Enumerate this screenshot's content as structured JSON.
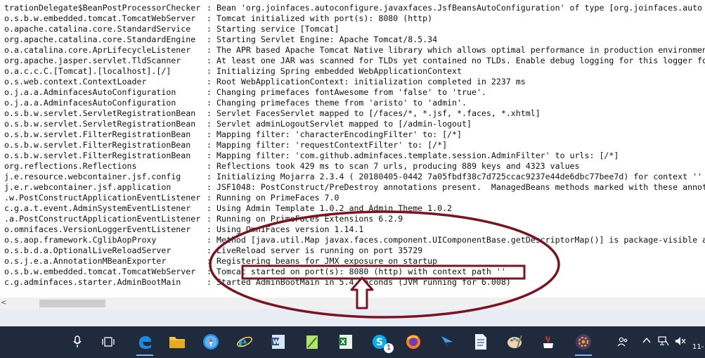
{
  "console": {
    "lines": [
      {
        "logger": "trationDelegate$BeanPostProcessorChecker",
        "message": "Bean 'org.joinfaces.autoconfigure.javaxfaces.JsfBeansAutoConfiguration' of type [org.joinfaces.auto"
      },
      {
        "logger": "o.s.b.w.embedded.tomcat.TomcatWebServer",
        "message": "Tomcat initialized with port(s): 8080 (http)"
      },
      {
        "logger": "o.apache.catalina.core.StandardService",
        "message": "Starting service [Tomcat]"
      },
      {
        "logger": "org.apache.catalina.core.StandardEngine",
        "message": "Starting Servlet Engine: Apache Tomcat/8.5.34"
      },
      {
        "logger": "o.a.catalina.core.AprLifecycleListener",
        "message": "The APR based Apache Tomcat Native library which allows optimal performance in production environment"
      },
      {
        "logger": "org.apache.jasper.servlet.TldScanner",
        "message": "At least one JAR was scanned for TLDs yet contained no TLDs. Enable debug logging for this logger for"
      },
      {
        "logger": "o.a.c.c.C.[Tomcat].[localhost].[/]",
        "message": "Initializing Spring embedded WebApplicationContext"
      },
      {
        "logger": "o.s.web.context.ContextLoader",
        "message": "Root WebApplicationContext: initialization completed in 2237 ms"
      },
      {
        "logger": "o.j.a.a.AdminfacesAutoConfiguration",
        "message": "Changing primefaces fontAwesome from 'false' to 'true'."
      },
      {
        "logger": "o.j.a.a.AdminfacesAutoConfiguration",
        "message": "Changing primefaces theme from 'aristo' to 'admin'."
      },
      {
        "logger": "o.s.b.w.servlet.ServletRegistrationBean",
        "message": "Servlet FacesServlet mapped to [/faces/*, *.jsf, *.faces, *.xhtml]"
      },
      {
        "logger": "o.s.b.w.servlet.ServletRegistrationBean",
        "message": "Servlet adminLogoutServlet mapped to [/admin-logout]"
      },
      {
        "logger": "o.s.b.w.servlet.FilterRegistrationBean",
        "message": "Mapping filter: 'characterEncodingFilter' to: [/*]"
      },
      {
        "logger": "o.s.b.w.servlet.FilterRegistrationBean",
        "message": "Mapping filter: 'requestContextFilter' to: [/*]"
      },
      {
        "logger": "o.s.b.w.servlet.FilterRegistrationBean",
        "message": "Mapping filter: 'com.github.adminfaces.template.session.AdminFilter' to urls: [/*]"
      },
      {
        "logger": "org.reflections.Reflections",
        "message": "Reflections took 429 ms to scan 7 urls, producing 889 keys and 4323 values"
      },
      {
        "logger": "j.e.resource.webcontainer.jsf.config",
        "message": "Initializing Mojarra 2.3.4 ( 20180405-0442 7a05fbdf38c7d725ccac9237e44de6dbc77bee7d) for context ''"
      },
      {
        "logger": "j.e.r.webcontainer.jsf.application",
        "message": "JSF1048: PostConstruct/PreDestroy annotations present.  ManagedBeans methods marked with these annota"
      },
      {
        "logger": ".w.PostConstructApplicationEventListener",
        "message": "Running on PrimeFaces 7.0"
      },
      {
        "logger": "c.g.a.t.event.AdminSystemEventListener",
        "message": "Using Admin Template 1.0.2 and Admin Theme 1.0.2"
      },
      {
        "logger": ".a.PostConstructApplicationEventListener",
        "message": "Running on PrimeFaces Extensions 6.2.9"
      },
      {
        "logger": "o.omnifaces.VersionLoggerEventListener",
        "message": "Using OmniFaces version 1.14.1"
      },
      {
        "logger": "o.s.aop.framework.CglibAopProxy",
        "message": "Method [java.util.Map javax.faces.component.UIComponentBase.getDescriptorMap()] is package-visible a"
      },
      {
        "logger": "o.s.b.d.a.OptionalLiveReloadServer",
        "message": "LiveReload server is running on port 35729"
      },
      {
        "logger": "o.s.j.e.a.AnnotationMBeanExporter",
        "message": "Registering beans for JMX exposure on startup"
      },
      {
        "logger": "o.s.b.w.embedded.tomcat.TomcatWebServer",
        "message": "Tomcat started on port(s): 8080 (http) with context path ''"
      },
      {
        "logger": "c.g.adminfaces.starter.AdminBootMain",
        "message": "Started AdminBootMain in 5.4 seconds (JVM running for 6.008)"
      }
    ],
    "separator": ":"
  },
  "scrollbar": {
    "left_arrow": "<"
  },
  "taskbar": {
    "skype_badge": "1",
    "clock_partial": "11-"
  },
  "colors": {
    "annotation": "#7a1420",
    "taskbar": "#1f2a3c"
  }
}
